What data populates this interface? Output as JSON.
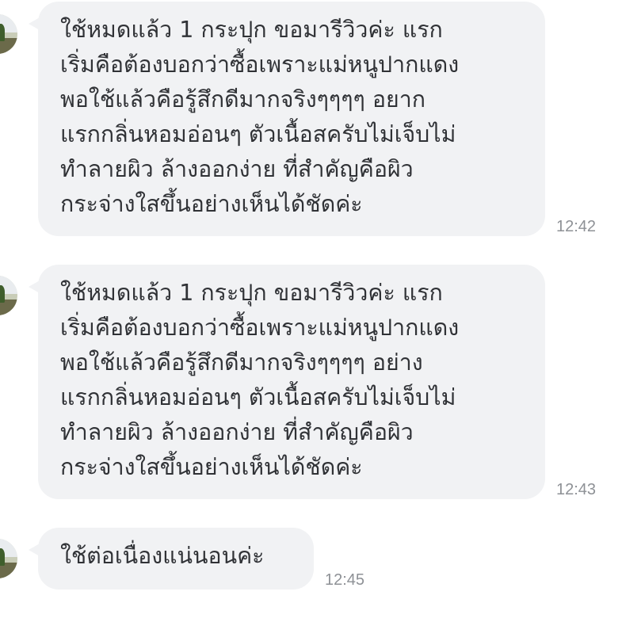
{
  "messages": [
    {
      "lines": [
        "ใช้หมดแล้ว 1 กระปุก ขอมารีวิวค่ะ แรก",
        "เริ่มคือต้องบอกว่าซื้อเพราะแม่หนูปากแดง",
        "พอใช้แล้วคือรู้สึกดีมากจริงๆๆๆๆ อยาก",
        "แรกกลิ่นหอมอ่อนๆ ตัวเนื้อสครับไม่เจ็บไม่",
        "ทำลายผิว ล้างออกง่าย ที่สำคัญคือผิว",
        "กระจ่างใสขึ้นอย่างเห็นได้ชัดค่ะ"
      ],
      "time": "12:42"
    },
    {
      "lines": [
        "ใช้หมดแล้ว 1 กระปุก ขอมารีวิวค่ะ แรก",
        "เริ่มคือต้องบอกว่าซื้อเพราะแม่หนูปากแดง",
        "พอใช้แล้วคือรู้สึกดีมากจริงๆๆๆๆ อย่าง",
        "แรกกลิ่นหอมอ่อนๆ ตัวเนื้อสครับไม่เจ็บไม่",
        "ทำลายผิว ล้างออกง่าย ที่สำคัญคือผิว",
        "กระจ่างใสขึ้นอย่างเห็นได้ชัดค่ะ"
      ],
      "time": "12:43"
    },
    {
      "lines": [
        "ใช้ต่อเนื่องแน่นอนค่ะ"
      ],
      "time": "12:45"
    }
  ],
  "colors": {
    "bubble": "#f1f2f4",
    "text": "#303236",
    "timestamp": "#8e9196"
  }
}
